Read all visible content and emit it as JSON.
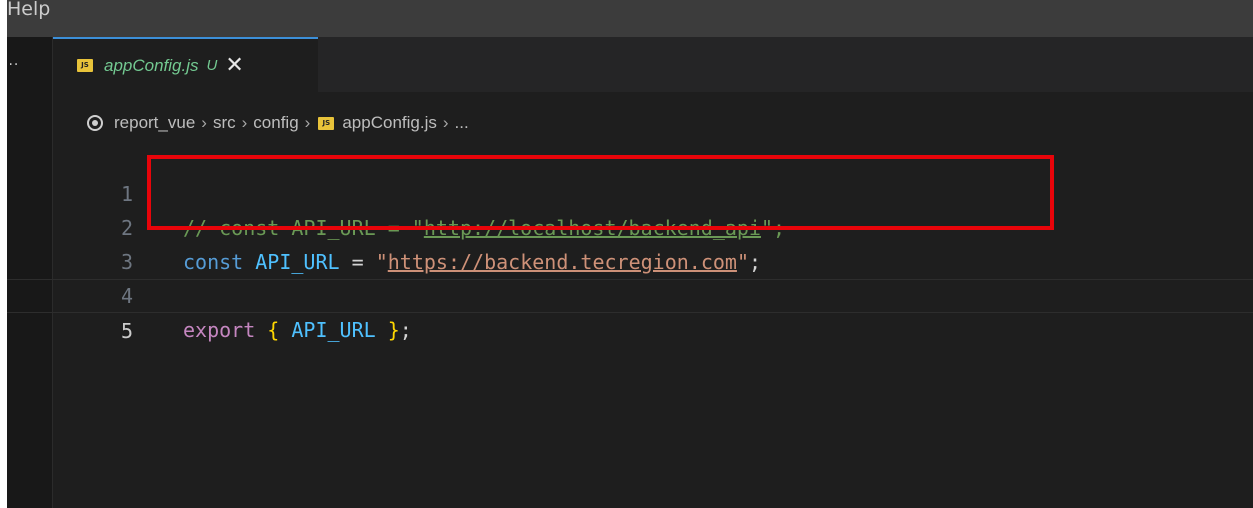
{
  "menubar": {
    "help_label": "Help"
  },
  "sidebar": {
    "overflow_dots": "···"
  },
  "tab": {
    "icon": "JS",
    "filename": "appConfig.js",
    "badge": "U",
    "close": "✕"
  },
  "breadcrumb": {
    "items": [
      "report_vue",
      "src",
      "config",
      "appConfig.js",
      "..."
    ],
    "separator": "›"
  },
  "editor": {
    "lines": [
      {
        "number": "1",
        "comment": "// const API_URL = ",
        "comment_url": "http://localhost/backend_api",
        "comment_end": "\";"
      },
      {
        "number": "2",
        "keyword": "const",
        "var": "API_URL",
        "op": "=",
        "quote_open": "\"",
        "url": "https://backend.tecregion.com",
        "quote_close": "\"",
        "semi": ";"
      },
      {
        "number": "3"
      },
      {
        "number": "4",
        "keyword": "export",
        "brace_open": "{",
        "var": "API_URL",
        "brace_close": "}",
        "semi": ";"
      },
      {
        "number": "5"
      }
    ]
  },
  "colors": {
    "highlight_box": "#e8040a",
    "string": "#ce9178",
    "keyword": "#569cd6",
    "variable": "#4fc1ff",
    "export_keyword": "#c586c0",
    "comment": "#6a9955",
    "tab_modified": "#73c991"
  }
}
